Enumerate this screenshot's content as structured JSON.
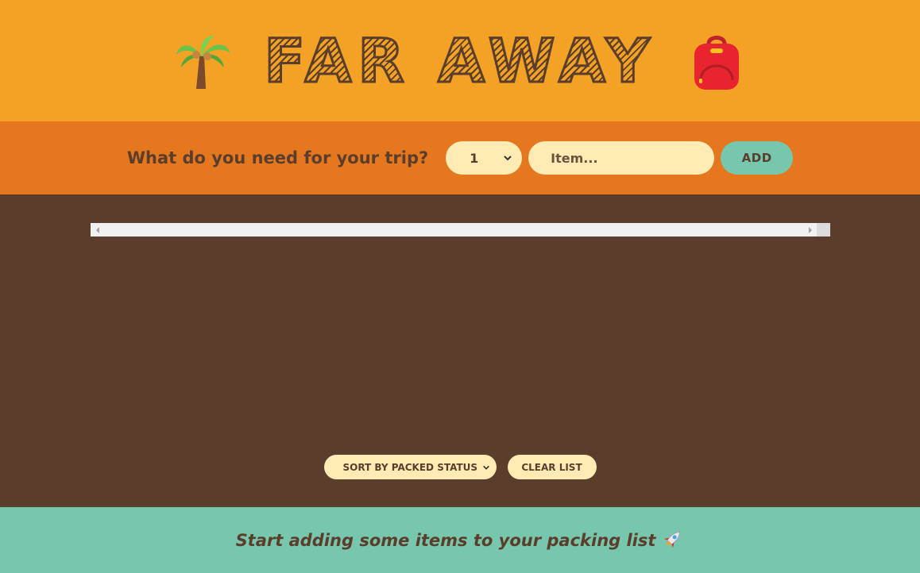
{
  "header": {
    "title": "FAR AWAY",
    "left_icon": "palm-tree-icon",
    "right_icon": "backpack-icon"
  },
  "form": {
    "question": "What do you need for your trip?",
    "quantity_value": "1",
    "item_placeholder": "Item...",
    "add_label": "ADD"
  },
  "list": {
    "sort_value": "SORT BY PACKED STATUS",
    "clear_label": "CLEAR LIST"
  },
  "footer": {
    "stats_text": "Start adding some items to your packing list",
    "stats_icon": "rocket-icon"
  },
  "colors": {
    "header_bg": "#f4a226",
    "form_bg": "#e5771f",
    "list_bg": "#5a3e2b",
    "footer_bg": "#76c7ad",
    "input_bg": "#ffebb3",
    "text": "#5a3e2b"
  }
}
